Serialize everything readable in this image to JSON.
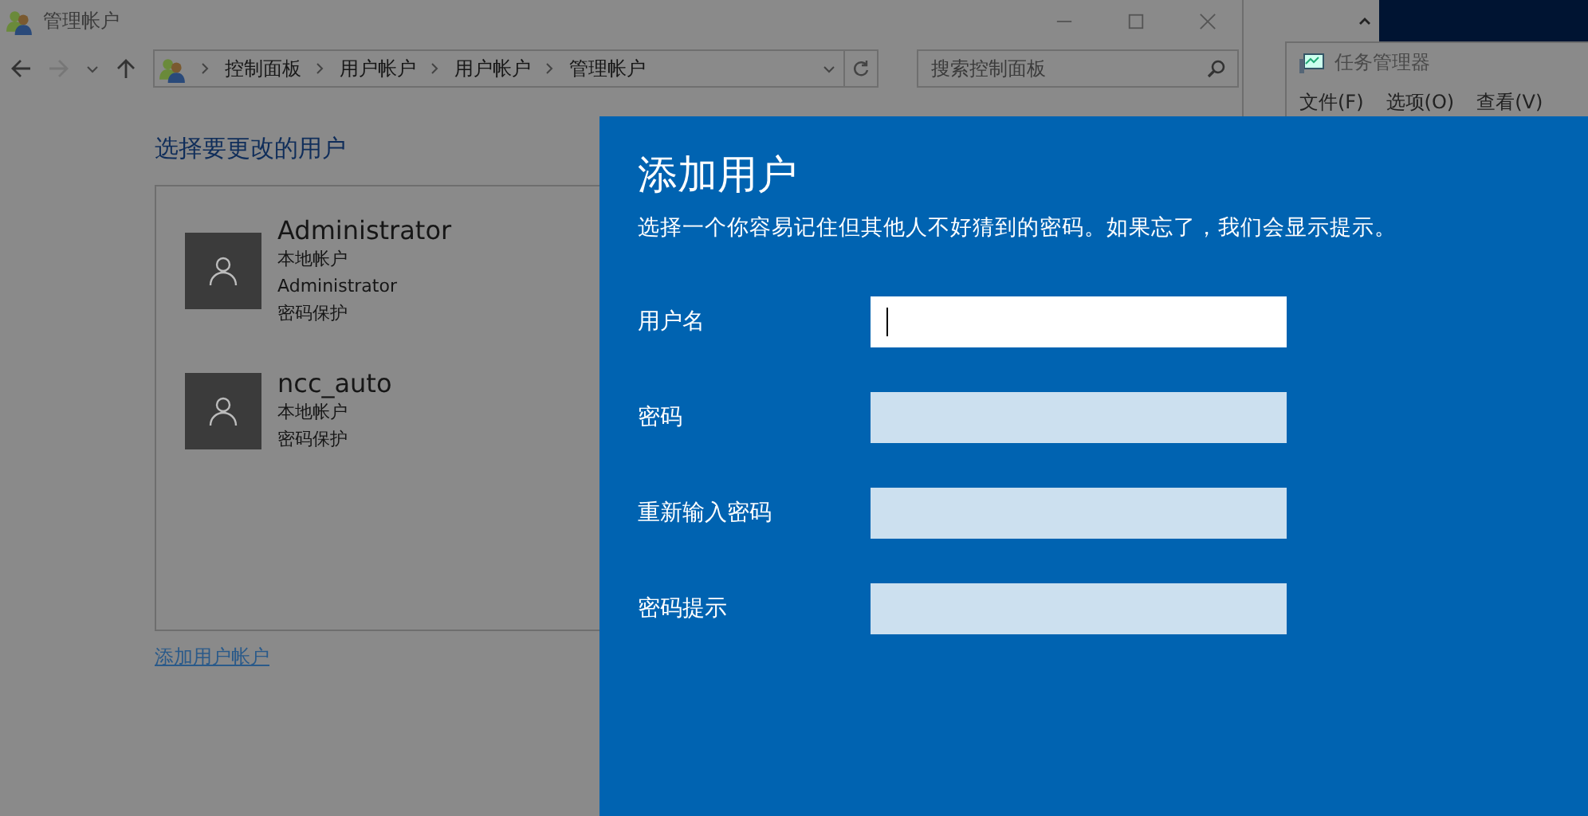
{
  "window": {
    "title": "管理帐户",
    "breadcrumb": [
      "控制面板",
      "用户帐户",
      "用户帐户",
      "管理帐户"
    ],
    "search": {
      "placeholder": "搜索控制面板"
    }
  },
  "heading": "选择要更改的用户",
  "users": [
    {
      "name": "Administrator",
      "details": [
        "本地帐户",
        "Administrator",
        "密码保护"
      ]
    },
    {
      "name": "ncc_auto",
      "details": [
        "本地帐户",
        "密码保护"
      ]
    }
  ],
  "add_user_link": "添加用户帐户",
  "task_manager": {
    "title": "任务管理器",
    "menu": [
      "文件(F)",
      "选项(O)",
      "查看(V)"
    ]
  },
  "dialog": {
    "title": "添加用户",
    "description": "选择一个你容易记住但其他人不好猜到的密码。如果忘了，我们会显示提示。",
    "fields": [
      {
        "label": "用户名",
        "focused": true
      },
      {
        "label": "密码",
        "focused": false
      },
      {
        "label": "重新输入密码",
        "focused": false
      },
      {
        "label": "密码提示",
        "focused": false
      }
    ]
  }
}
